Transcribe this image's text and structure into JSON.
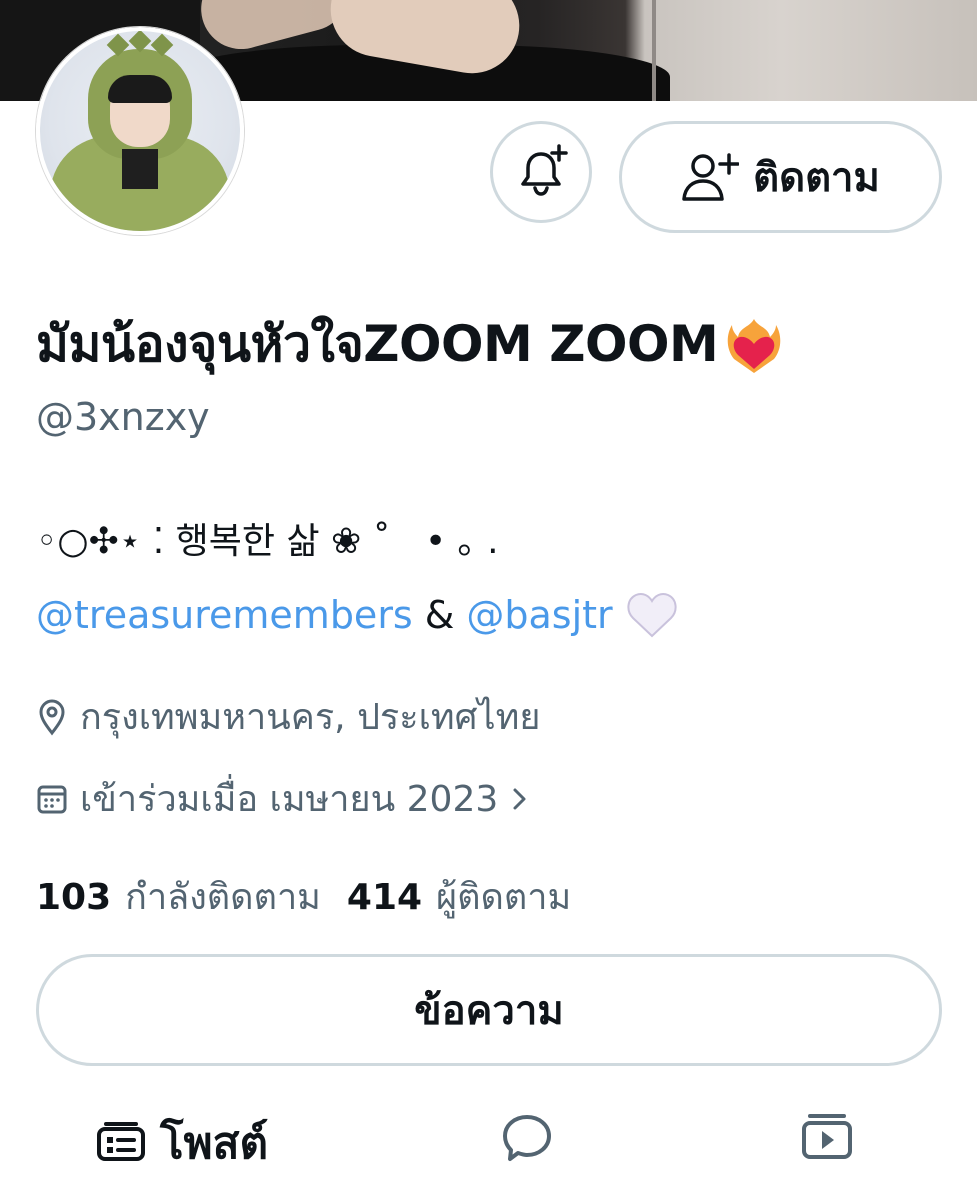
{
  "profile": {
    "display_name": "มัมน้องจุนหัวใจZOOM ZOOM",
    "name_emoji": "heart-on-fire-emoji",
    "handle": "@3xnzxy",
    "bio_line1": "◦○✣⋆ ⁚ 행복한 삶 ❀ ˚   • ｡ .",
    "bio_mention1": "@treasuremembers",
    "bio_amp": "&",
    "bio_mention2": "@basjtr",
    "bio_emoji": "white-heart-emoji",
    "location": "กรุงเทพมหานคร, ประเทศไทย",
    "joined": "เข้าร่วมเมื่อ เมษายน 2023"
  },
  "actions": {
    "follow_label": "ติดตาม",
    "message_label": "ข้อความ"
  },
  "stats": {
    "following_count": "103",
    "following_label": "กำลังติดตาม",
    "followers_count": "414",
    "followers_label": "ผู้ติดตาม"
  },
  "tabs": {
    "posts_label": "โพสต์"
  },
  "colors": {
    "link": "#4a99e9",
    "secondary_text": "#536471",
    "border": "#cfd9de",
    "primary_text": "#0f1419"
  }
}
